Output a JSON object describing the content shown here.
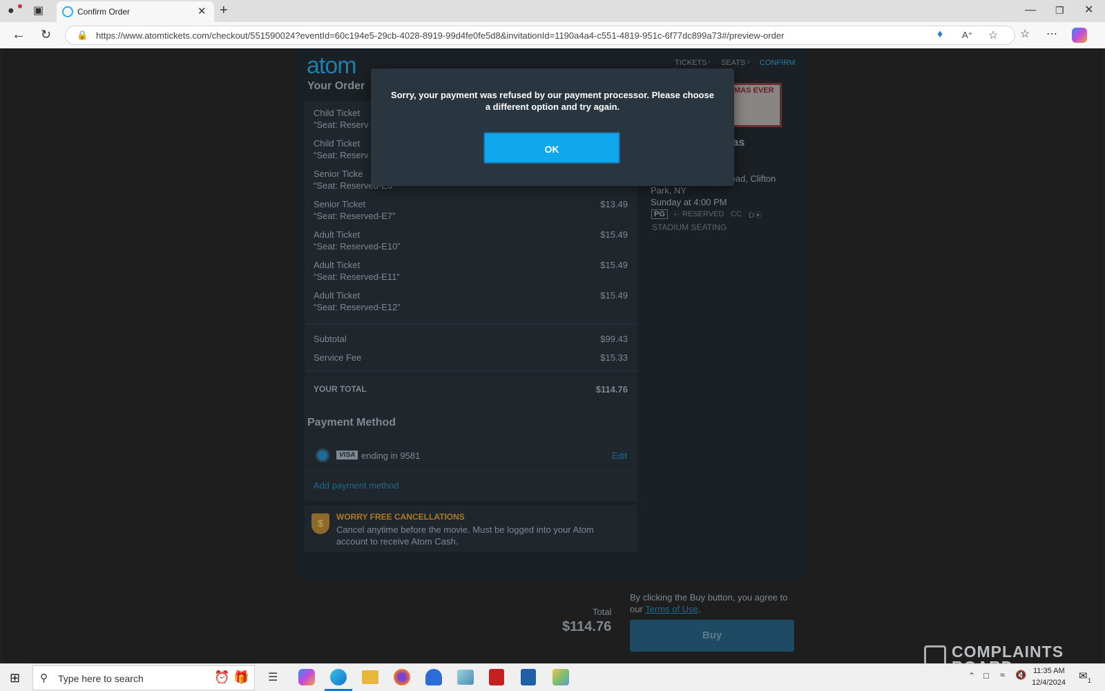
{
  "browser": {
    "tab_title": "Confirm Order",
    "url": "https://www.atomtickets.com/checkout/551590024?eventId=60c194e5-29cb-4028-8919-99d4fe0fe5d8&invitationId=1190a4a4-c551-4819-951c-6f77dc899a73#/preview-order",
    "icons": [
      "profile-icon",
      "tab-actions-icon",
      "new-tab-icon",
      "back-icon",
      "refresh-icon",
      "lock-icon",
      "coupon-icon",
      "read-aloud-icon",
      "favorite-icon",
      "favorites-bar-icon",
      "more-icon",
      "copilot-icon"
    ]
  },
  "header": {
    "logo": "atom",
    "steps": [
      "TICKETS",
      "SEATS",
      "CONFIRM"
    ]
  },
  "order": {
    "heading": "Your Order",
    "items": [
      {
        "name": "Child Ticket",
        "seat": "“Seat: Reserv",
        "price": ""
      },
      {
        "name": "Child Ticket",
        "seat": "“Seat: Reserv",
        "price": ""
      },
      {
        "name": "Senior Ticke",
        "seat": "“Seat: Reserved-E6”",
        "price": ""
      },
      {
        "name": "Senior Ticket",
        "seat": "“Seat: Reserved-E7”",
        "price": "$13.49"
      },
      {
        "name": "Adult Ticket",
        "seat": "“Seat: Reserved-E10”",
        "price": "$15.49"
      },
      {
        "name": "Adult Ticket",
        "seat": "“Seat: Reserved-E11”",
        "price": "$15.49"
      },
      {
        "name": "Adult Ticket",
        "seat": "“Seat: Reserved-E12”",
        "price": "$15.49"
      }
    ],
    "subtotal_label": "Subtotal",
    "subtotal": "$99.43",
    "fee_label": "Service Fee",
    "fee": "$15.33",
    "total_label": "YOUR TOTAL",
    "total": "$114.76"
  },
  "movie": {
    "poster_text": "ISTMAS EVER",
    "title_fragment": "tmas",
    "address": "y Road, Clifton",
    "city": "Park, NY",
    "showtime": "Sunday at 4:00 PM",
    "rating": "PG",
    "reserved": "RESERVED",
    "cc": "CC",
    "features": "STADIUM SEATING"
  },
  "payment": {
    "heading": "Payment Method",
    "card_brand": "VISA",
    "card_label": "ending in 9581",
    "edit": "Edit",
    "add": "Add payment method"
  },
  "cancellation": {
    "title": "WORRY FREE CANCELLATIONS",
    "body": "Cancel anytime before the movie. Must be logged into your Atom account to receive Atom Cash."
  },
  "footer": {
    "total_label": "Total",
    "total": "$114.76",
    "agree_text": "By clicking the Buy button, you agree to our",
    "terms": "Terms of Use",
    "period": ".",
    "buy": "Buy"
  },
  "modal": {
    "message": "Sorry, your payment was refused by our payment processor. Please choose a different option and try again.",
    "ok": "OK"
  },
  "taskbar": {
    "search_placeholder": "Type here to search",
    "time": "11:35 AM",
    "date": "12/4/2024",
    "notification_count": "1"
  },
  "watermark": "COMPLAINTS BOARD",
  "colors": {
    "accent": "#11a7ec",
    "modal_bg": "#293640",
    "page_bg": "#1b2024",
    "orange": "#c98a2b"
  }
}
